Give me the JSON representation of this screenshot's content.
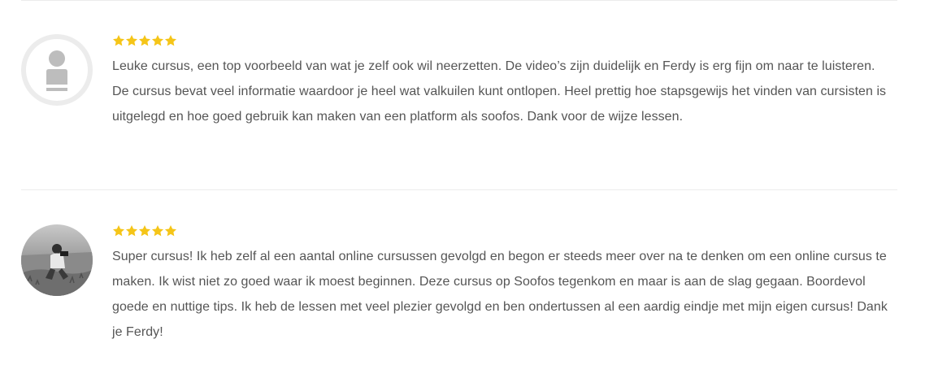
{
  "reviews": [
    {
      "rating": 5,
      "avatar": "default-user-avatar",
      "text": "Leuke cursus, een top voorbeeld van wat je zelf ook wil neerzetten. De video’s zijn duidelijk en Ferdy is erg fijn om naar te luisteren. De cursus bevat veel informatie waardoor je heel wat valkuilen kunt ontlopen. Heel prettig hoe stapsgewijs het vinden van cursisten is uitgelegd en hoe goed gebruik kan maken van een platform als soofos. Dank voor de wijze lessen."
    },
    {
      "rating": 5,
      "avatar": "photographer-photo-avatar",
      "text": "Super cursus! Ik heb zelf al een aantal online cursussen gevolgd en begon er steeds meer over na te denken om een online cursus te maken. Ik wist niet zo goed waar ik moest beginnen. Deze cursus op Soofos tegenkom en maar is aan de slag gegaan. Boordevol goede en nuttige tips. Ik heb de lessen met veel plezier gevolgd en ben ondertussen al een aardig eindje met mijn eigen cursus! Dank je Ferdy!"
    }
  ],
  "colors": {
    "star": "#f5c518",
    "text": "#555555",
    "divider": "#ececec",
    "avatar_bg": "#ececec",
    "avatar_figure": "#bdbdbd"
  }
}
